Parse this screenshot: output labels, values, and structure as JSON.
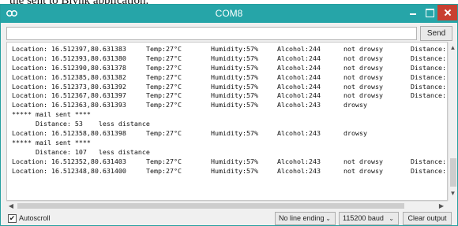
{
  "caption": "the sent to Blynk application.",
  "window": {
    "title": "COM8"
  },
  "send_row": {
    "input_value": "",
    "send_label": "Send"
  },
  "console": {
    "rows": [
      {
        "type": "reading",
        "location": "Location: 16.512397,80.631383",
        "temp": "Temp:27°C",
        "humidity": "Humidity:57%",
        "alcohol": "Alcohol:244",
        "state": "not drowsy",
        "distance": "Distance:"
      },
      {
        "type": "reading",
        "location": "Location: 16.512393,80.631380",
        "temp": "Temp:27°C",
        "humidity": "Humidity:57%",
        "alcohol": "Alcohol:244",
        "state": "not drowsy",
        "distance": "Distance:"
      },
      {
        "type": "reading",
        "location": "Location: 16.512390,80.631378",
        "temp": "Temp:27°C",
        "humidity": "Humidity:57%",
        "alcohol": "Alcohol:244",
        "state": "not drowsy",
        "distance": "Distance:"
      },
      {
        "type": "reading",
        "location": "Location: 16.512385,80.631382",
        "temp": "Temp:27°C",
        "humidity": "Humidity:57%",
        "alcohol": "Alcohol:244",
        "state": "not drowsy",
        "distance": "Distance:"
      },
      {
        "type": "reading",
        "location": "Location: 16.512373,80.631392",
        "temp": "Temp:27°C",
        "humidity": "Humidity:57%",
        "alcohol": "Alcohol:244",
        "state": "not drowsy",
        "distance": "Distance:"
      },
      {
        "type": "reading",
        "location": "Location: 16.512367,80.631397",
        "temp": "Temp:27°C",
        "humidity": "Humidity:57%",
        "alcohol": "Alcohol:244",
        "state": "not drowsy",
        "distance": "Distance:"
      },
      {
        "type": "reading",
        "location": "Location: 16.512363,80.631393",
        "temp": "Temp:27°C",
        "humidity": "Humidity:57%",
        "alcohol": "Alcohol:243",
        "state": "drowsy",
        "distance": ""
      },
      {
        "type": "text",
        "text": "***** mail sent ****"
      },
      {
        "type": "text",
        "text": "      Distance: 53    less distance"
      },
      {
        "type": "reading",
        "location": "Location: 16.512358,80.631398",
        "temp": "Temp:27°C",
        "humidity": "Humidity:57%",
        "alcohol": "Alcohol:243",
        "state": "drowsy",
        "distance": ""
      },
      {
        "type": "text",
        "text": "***** mail sent ****"
      },
      {
        "type": "text",
        "text": "      Distance: 107   less distance"
      },
      {
        "type": "reading",
        "location": "Location: 16.512352,80.631403",
        "temp": "Temp:27°C",
        "humidity": "Humidity:57%",
        "alcohol": "Alcohol:243",
        "state": "not drowsy",
        "distance": "Distance:"
      },
      {
        "type": "reading",
        "location": "Location: 16.512348,80.631400",
        "temp": "Temp:27°C",
        "humidity": "Humidity:57%",
        "alcohol": "Alcohol:243",
        "state": "not drowsy",
        "distance": "Distance:"
      }
    ]
  },
  "bottom_bar": {
    "autoscroll_checked": true,
    "autoscroll_label": "Autoscroll",
    "line_ending": "No line ending",
    "baud_rate": "115200 baud",
    "clear_label": "Clear output"
  },
  "colors": {
    "titlebar": "#26a5a8",
    "close_button": "#c84031"
  },
  "icons": [
    "app-icon",
    "minimize-icon",
    "maximize-icon",
    "close-icon",
    "checkmark-icon",
    "chevron-down-icon",
    "scroll-up-icon",
    "scroll-down-icon",
    "scroll-left-icon",
    "scroll-right-icon"
  ]
}
